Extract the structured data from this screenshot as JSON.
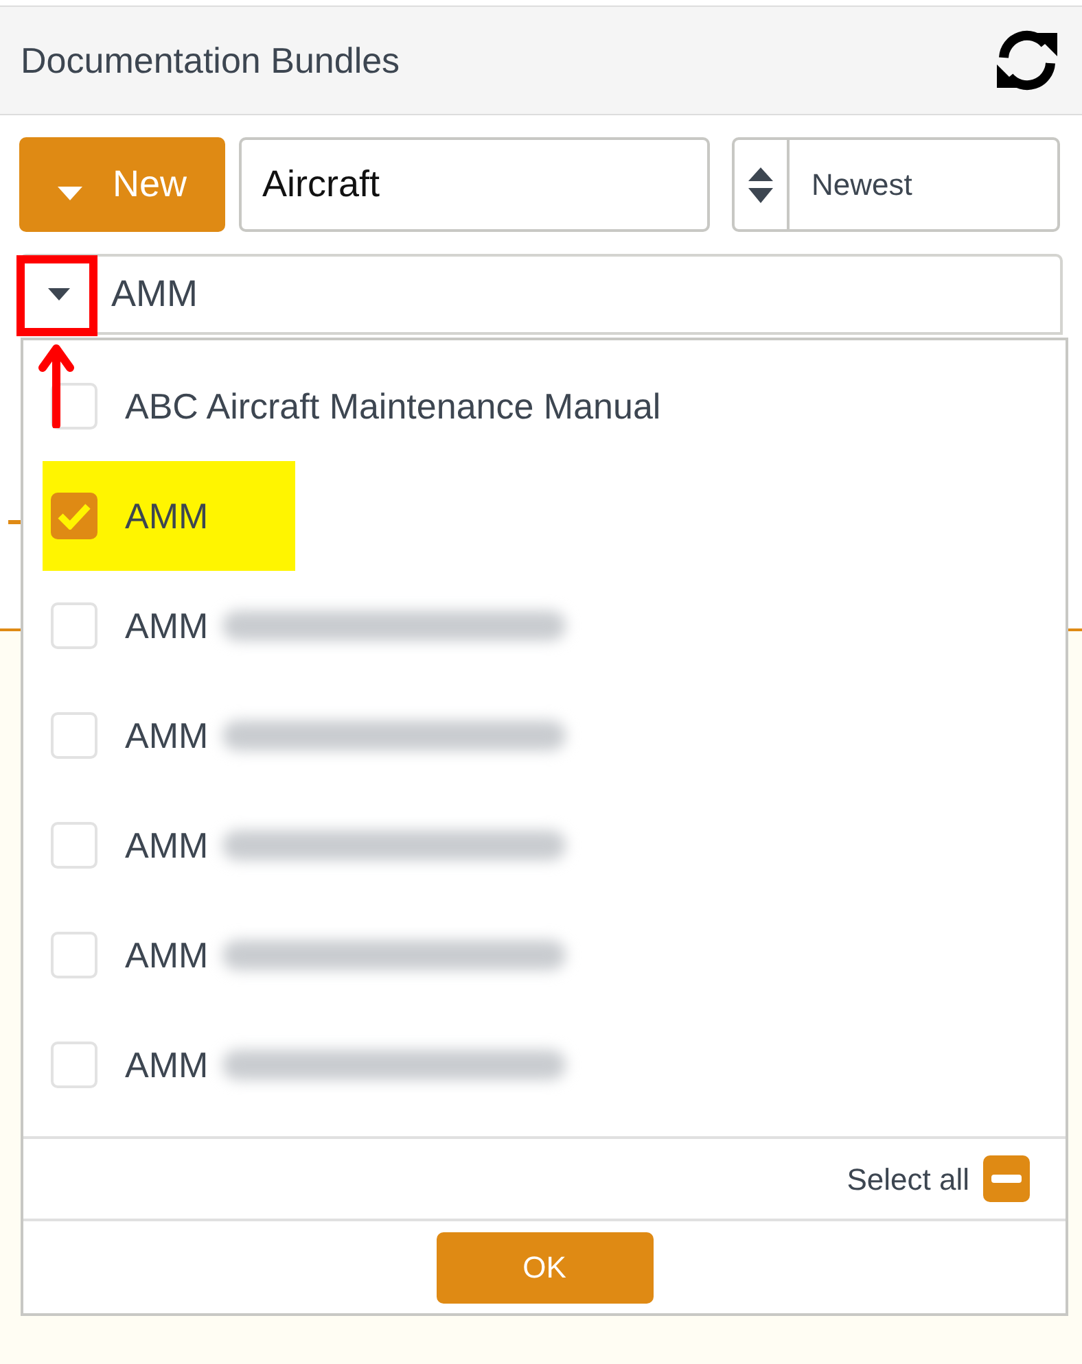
{
  "header": {
    "title": "Documentation Bundles"
  },
  "toolbar": {
    "new_button": "New",
    "search": {
      "value": "Aircraft"
    },
    "sort": {
      "value": "Newest"
    }
  },
  "filter": {
    "value": "AMM",
    "expanded": true
  },
  "options": [
    {
      "label": "ABC Aircraft Maintenance Manual",
      "checked": false,
      "highlighted": false,
      "redacted": false
    },
    {
      "label": "AMM",
      "checked": true,
      "highlighted": true,
      "redacted": false
    },
    {
      "label": "AMM",
      "checked": false,
      "highlighted": false,
      "redacted": true
    },
    {
      "label": "AMM",
      "checked": false,
      "highlighted": false,
      "redacted": true
    },
    {
      "label": "AMM",
      "checked": false,
      "highlighted": false,
      "redacted": true
    },
    {
      "label": "AMM",
      "checked": false,
      "highlighted": false,
      "redacted": true
    },
    {
      "label": "AMM",
      "checked": false,
      "highlighted": false,
      "redacted": true
    }
  ],
  "select_all": {
    "label": "Select all",
    "partial": true
  },
  "ok_button": "OK",
  "annotation": {
    "caret_marked": true
  }
}
